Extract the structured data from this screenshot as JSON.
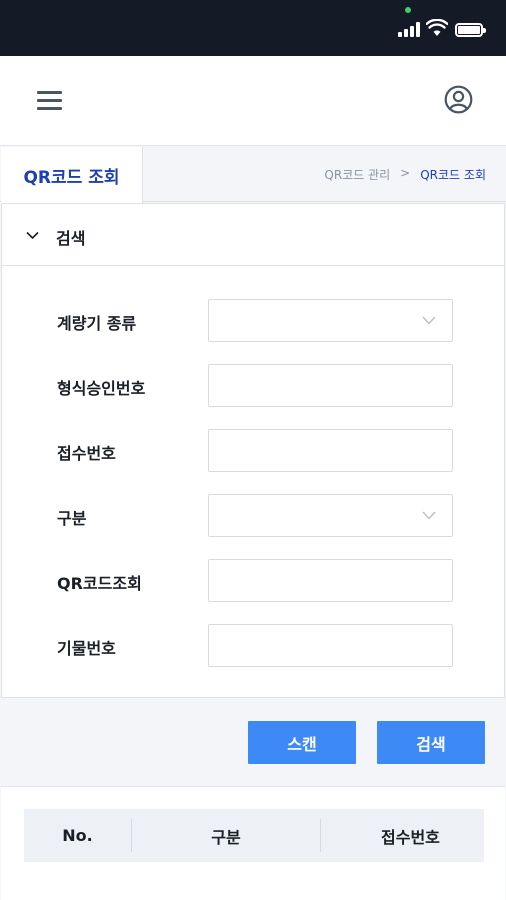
{
  "status_bar": {
    "icons": [
      "signal-icon",
      "wifi-icon",
      "battery-icon"
    ]
  },
  "app_bar": {
    "menu_icon": "hamburger-menu-icon",
    "profile_icon": "user-profile-icon"
  },
  "page": {
    "tab_title": "QR코드 조회",
    "breadcrumb": {
      "parent": "QR코드 관리",
      "separator": ">",
      "current": "QR코드 조회"
    }
  },
  "search": {
    "header": "검색",
    "fields": [
      {
        "label": "계량기 종류",
        "type": "select",
        "value": ""
      },
      {
        "label": "형식승인번호",
        "type": "text",
        "value": ""
      },
      {
        "label": "접수번호",
        "type": "text",
        "value": ""
      },
      {
        "label": "구분",
        "type": "select",
        "value": ""
      },
      {
        "label": "QR코드조회",
        "type": "text",
        "value": ""
      },
      {
        "label": "기물번호",
        "type": "text",
        "value": ""
      }
    ]
  },
  "actions": {
    "scan_label": "스캔",
    "search_label": "검색"
  },
  "table": {
    "columns": [
      "No.",
      "구분",
      "접수번호"
    ]
  },
  "colors": {
    "accent": "#1f3fb5",
    "button": "#3d8af7",
    "status_bar": "#151b26"
  }
}
